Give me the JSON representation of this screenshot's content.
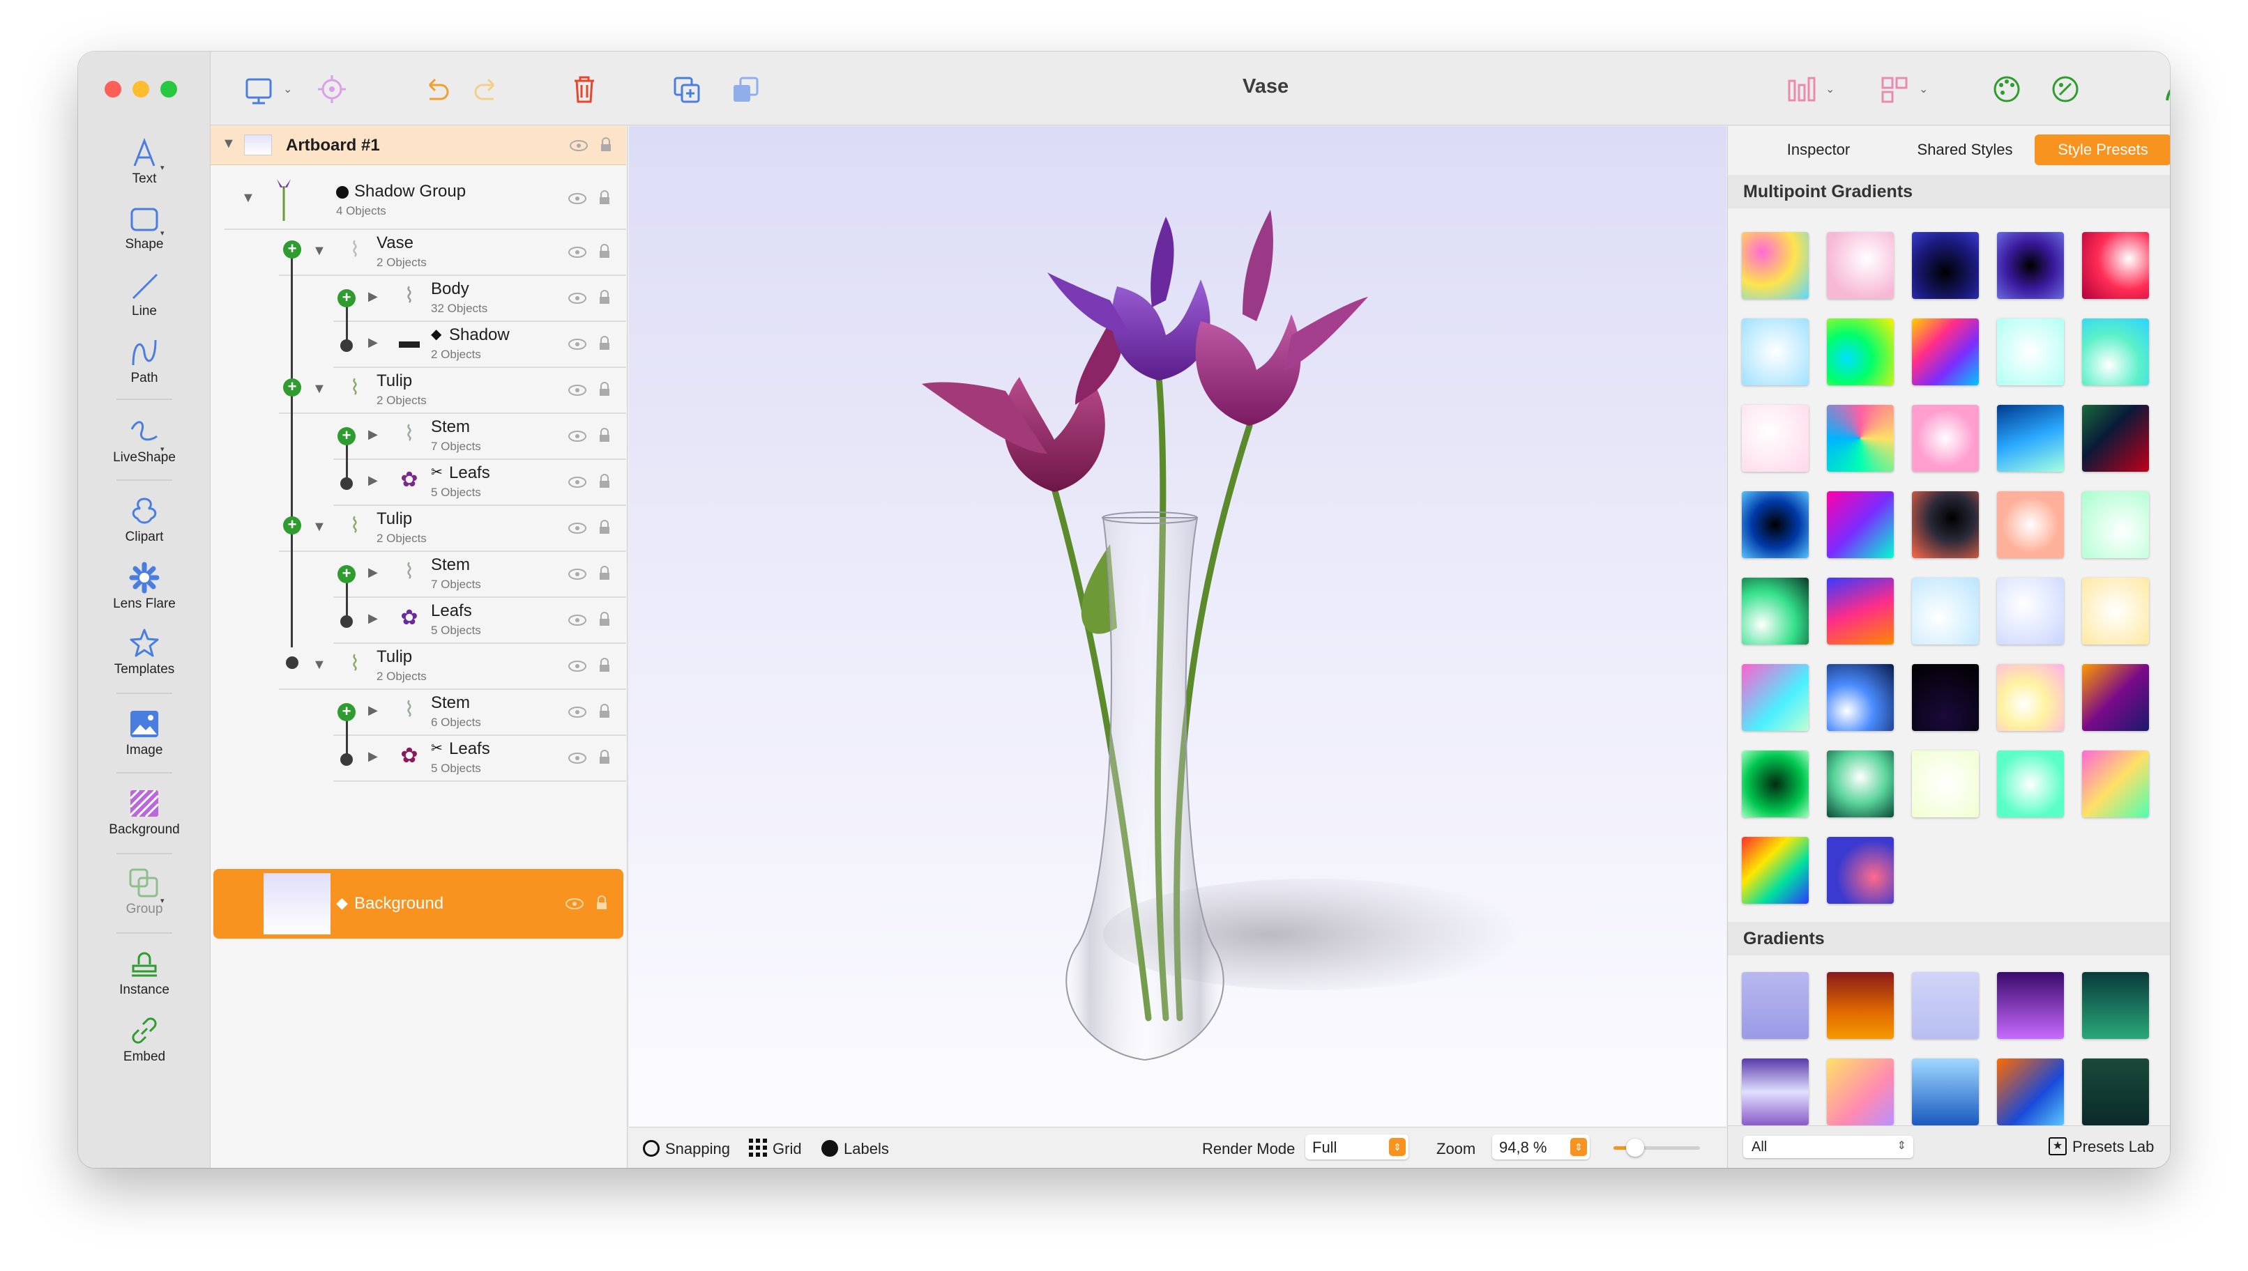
{
  "window": {
    "title": "Vase"
  },
  "tools": [
    {
      "label": "Text",
      "icon": "text-icon"
    },
    {
      "label": "Shape",
      "icon": "shape-icon"
    },
    {
      "label": "Line",
      "icon": "line-icon"
    },
    {
      "label": "Path",
      "icon": "path-icon"
    },
    {
      "label": "LiveShape",
      "icon": "liveshape-icon"
    },
    {
      "label": "Clipart",
      "icon": "clipart-icon"
    },
    {
      "label": "Lens Flare",
      "icon": "lens-flare-icon"
    },
    {
      "label": "Templates",
      "icon": "templates-icon"
    },
    {
      "label": "Image",
      "icon": "image-icon"
    },
    {
      "label": "Background",
      "icon": "background-icon"
    },
    {
      "label": "Group",
      "icon": "group-icon"
    },
    {
      "label": "Instance",
      "icon": "instance-icon"
    },
    {
      "label": "Embed",
      "icon": "embed-icon"
    }
  ],
  "layers": {
    "artboard": "Artboard #1",
    "rows": [
      {
        "name": "Shadow Group",
        "sub": "4 Objects"
      },
      {
        "name": "Vase",
        "sub": "2 Objects"
      },
      {
        "name": "Body",
        "sub": "32 Objects"
      },
      {
        "name": "Shadow",
        "sub": "2 Objects"
      },
      {
        "name": "Tulip",
        "sub": "2 Objects"
      },
      {
        "name": "Stem",
        "sub": "7 Objects"
      },
      {
        "name": "Leafs",
        "sub": "5 Objects"
      },
      {
        "name": "Tulip",
        "sub": "2 Objects"
      },
      {
        "name": "Stem",
        "sub": "7 Objects"
      },
      {
        "name": "Leafs",
        "sub": "5 Objects"
      },
      {
        "name": "Tulip",
        "sub": "2 Objects"
      },
      {
        "name": "Stem",
        "sub": "6 Objects"
      },
      {
        "name": "Leafs",
        "sub": "5 Objects"
      }
    ],
    "background": "Background"
  },
  "statusbar": {
    "snapping": "Snapping",
    "grid": "Grid",
    "labels": "Labels",
    "render_mode_label": "Render Mode",
    "render_mode_value": "Full",
    "zoom_label": "Zoom",
    "zoom_value": "94,8 %",
    "zoom_slider": 0.25
  },
  "right_panel": {
    "tabs": [
      "Inspector",
      "Shared Styles",
      "Style Presets"
    ],
    "active_tab": "Style Presets",
    "sections": [
      "Multipoint Gradients",
      "Gradients"
    ],
    "filter": "All",
    "presets_lab": "Presets Lab"
  },
  "colors": {
    "accent": "#f7931e",
    "green": "#2e9c2e",
    "blue": "#4a7de0"
  }
}
